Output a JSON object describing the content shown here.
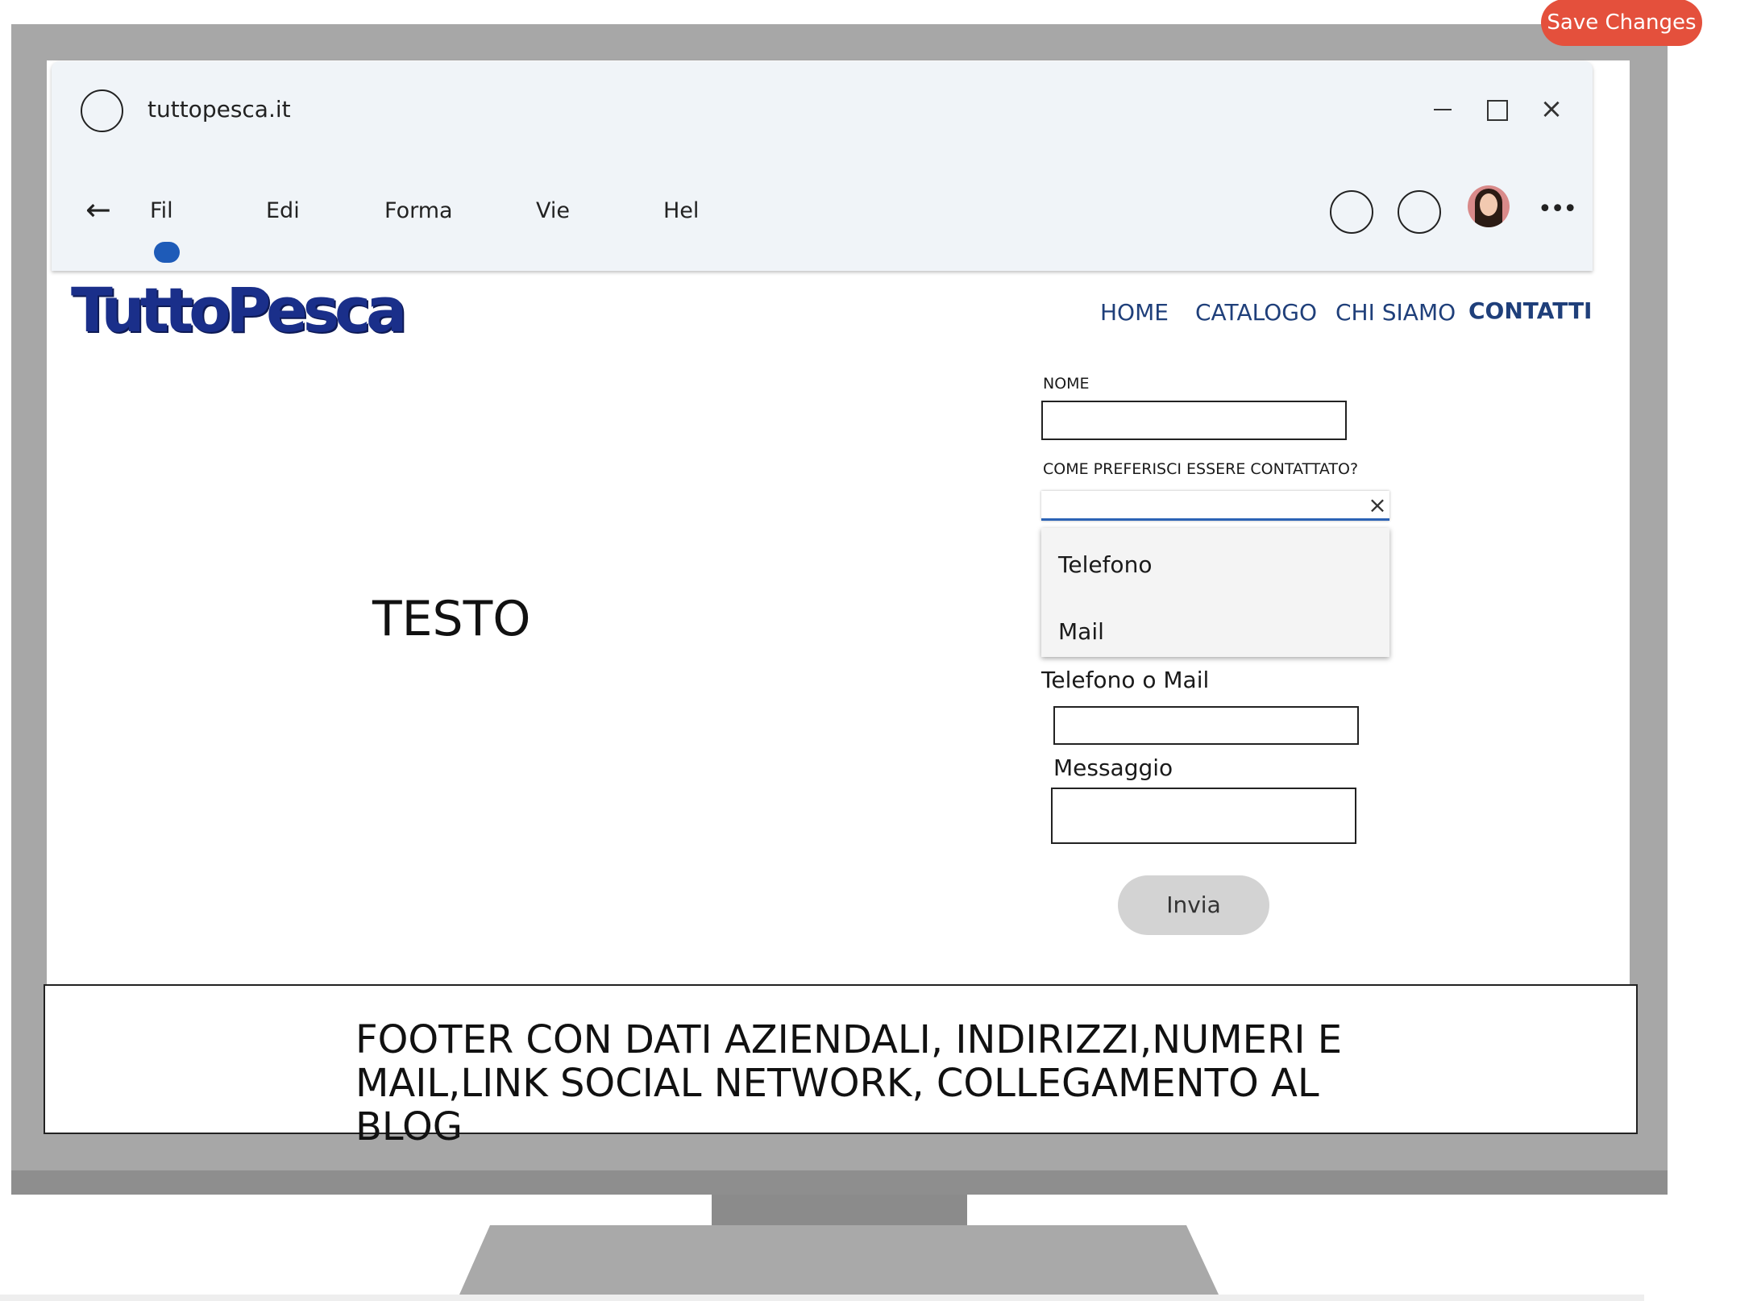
{
  "save_changes_label": "Save Changes",
  "browser": {
    "url": "tuttopesca.it",
    "menu": [
      "Fil",
      "Edi",
      "Forma",
      "Vie",
      "Hel"
    ],
    "more_label": "•••"
  },
  "site": {
    "logo_text": "TuttoPesca",
    "nav": [
      "HOME",
      "CATALOGO",
      "CHI SIAMO",
      "CONTATTI"
    ],
    "body_text": "TESTO"
  },
  "form": {
    "nome_label": "NOME",
    "contact_pref_label": "COME PREFERISCI ESSERE CONTATTATO?",
    "contact_options": [
      "Telefono",
      "Mail"
    ],
    "telefono_mail_label": "Telefono o Mail",
    "messaggio_label": "Messaggio",
    "submit_label": "Invia"
  },
  "footer": {
    "line1": "FOOTER CON DATI AZIENDALI, INDIRIZZI,NUMERI E",
    "line2": "MAIL,LINK SOCIAL NETWORK, COLLEGAMENTO AL BLOG"
  },
  "colors": {
    "save_button": "#e4503c",
    "nav_link": "#1f3f7a",
    "logo": "#1a2f8a",
    "active_dot": "#1e5bb8",
    "monitor": "#a7a7a7"
  }
}
